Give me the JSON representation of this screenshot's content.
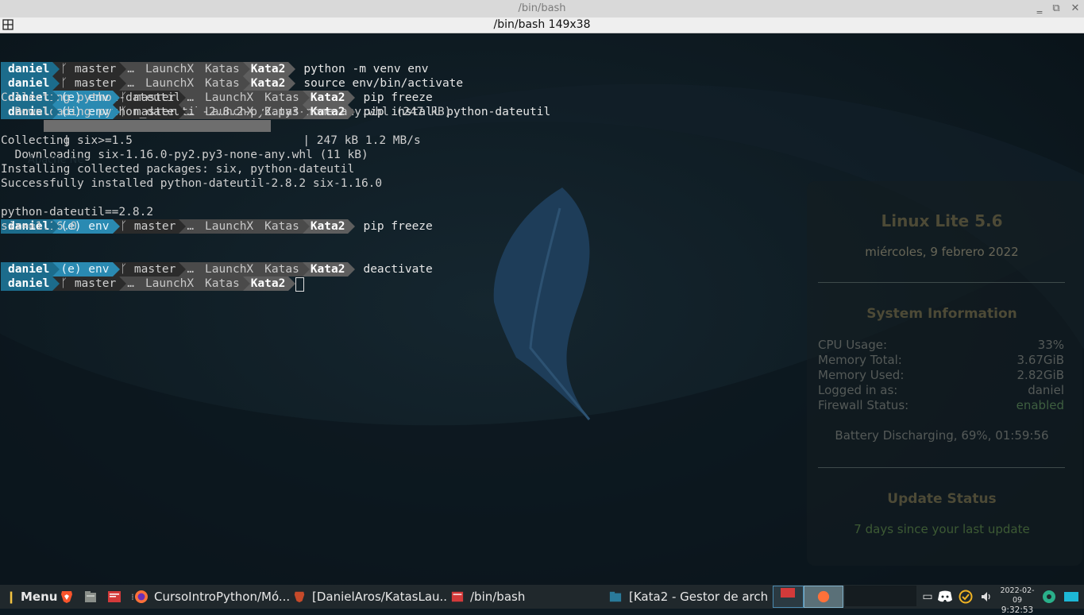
{
  "window": {
    "title": "/bin/bash",
    "tab_title": "/bin/bash 149x38",
    "minimize": "‗",
    "maximize": "⧉",
    "close": "✕"
  },
  "terminal": {
    "prompt_user": "daniel",
    "prompt_env": "(e) env",
    "prompt_branch": "ᚴ master",
    "prompt_ellipsis": "…",
    "prompt_dir1": "LaunchX",
    "prompt_dir2": "Katas",
    "prompt_dir3": "Kata2",
    "cmd1": "python -m venv env",
    "cmd2": "source env/bin/activate",
    "cmd3": "pip freeze",
    "cmd4": "pip install python-dateutil",
    "out1": "Collecting python-dateutil",
    "out2": "  Downloading python_dateutil-2.8.2-py2.py3-none-any.whl (247 kB)",
    "out3_left": "     |",
    "out3_right": "| 247 kB 1.2 MB/s",
    "progress_fraction": 1.0,
    "out4": "Collecting six>=1.5",
    "out5": "  Downloading six-1.16.0-py2.py3-none-any.whl (11 kB)",
    "out6": "Installing collected packages: six, python-dateutil",
    "out7": "Successfully installed python-dateutil-2.8.2 six-1.16.0",
    "cmd5": "pip freeze",
    "out8": "python-dateutil==2.8.2",
    "out9": "six==1.16.0",
    "cmd6": "deactivate",
    "ghost_text": "Apache Ne"
  },
  "conky": {
    "title": "Linux Lite 5.6",
    "date": "miércoles,  9 febrero 2022",
    "sysinfo_heading": "System Information",
    "rows": [
      {
        "label": "CPU Usage:",
        "value": "33%"
      },
      {
        "label": "Memory Total:",
        "value": "3.67GiB"
      },
      {
        "label": "Memory Used:",
        "value": "2.82GiB"
      },
      {
        "label": "Logged in as:",
        "value": "daniel"
      },
      {
        "label": "Firewall Status:",
        "value": "enabled"
      }
    ],
    "battery": "Battery Discharging, 69%, 01:59:56",
    "update_heading": "Update Status",
    "update_text": "7 days since your last update"
  },
  "taskbar": {
    "menu_label": "Menu",
    "task1": "CursoIntroPython/Mó...",
    "task2": "[DanielAros/KatasLau...",
    "task3": "/bin/bash",
    "task4": "[Kata2 - Gestor de arch...",
    "clock_date": "2022-02-09",
    "clock_time": "9:32:53"
  },
  "colors": {
    "user_segment": "#1c6c8c",
    "env_segment": "#2a8ab2",
    "background": "#0d1a22",
    "taskbar": "#20282c"
  }
}
